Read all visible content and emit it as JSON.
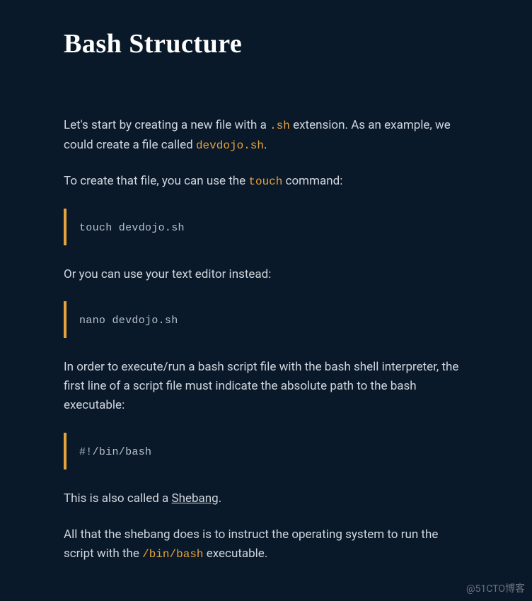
{
  "title": "Bash Structure",
  "p1_a": "Let's start by creating a new file with a ",
  "p1_code1": ".sh",
  "p1_b": " extension. As an example, we could create a file called ",
  "p1_code2": "devdojo.sh",
  "p1_c": ".",
  "p2_a": "To create that file, you can use the ",
  "p2_code1": "touch",
  "p2_b": " command:",
  "code1": "touch devdojo.sh",
  "p3": "Or you can use your text editor instead:",
  "code2": "nano devdojo.sh",
  "p4": "In order to execute/run a bash script file with the bash shell interpreter, the first line of a script file must indicate the absolute path to the bash executable:",
  "code3": "#!/bin/bash",
  "p5_a": "This is also called a ",
  "p5_link": "Shebang",
  "p5_b": ".",
  "p6_a": "All that the shebang does is to instruct the operating system to run the script with the ",
  "p6_code1": "/bin/bash",
  "p6_b": " executable.",
  "watermark": "@51CTO博客"
}
